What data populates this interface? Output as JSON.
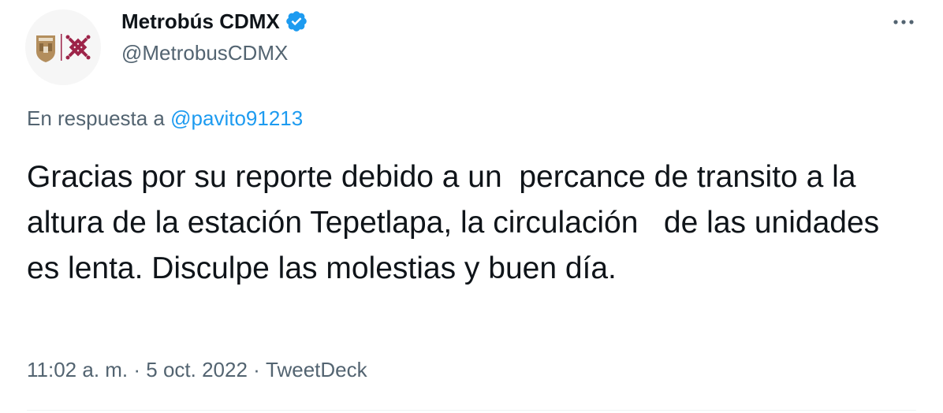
{
  "author": {
    "display_name": "Metrobús CDMX",
    "handle": "@MetrobusCDMX",
    "verified_icon": "verified-badge-icon",
    "avatar_icon": "metrobus-logo-icon"
  },
  "more_icon": "more-options-icon",
  "reply": {
    "prefix": "En respuesta a ",
    "mention": "@pavito91213"
  },
  "tweet": {
    "text": "Gracias por su reporte debido a un  percance de transito a la altura de la estación Tepetlapa, la circulación   de las unidades es lenta. Disculpe las molestias y buen día."
  },
  "meta": {
    "time": "11:02 a. m.",
    "separator": " · ",
    "date": "5 oct. 2022",
    "source": "TweetDeck"
  },
  "colors": {
    "text": "#0f1419",
    "secondary": "#536471",
    "link": "#1d9bf0",
    "verified": "#1d9bf0",
    "logo_maroon": "#9d2449",
    "logo_gold": "#b38e5d"
  }
}
